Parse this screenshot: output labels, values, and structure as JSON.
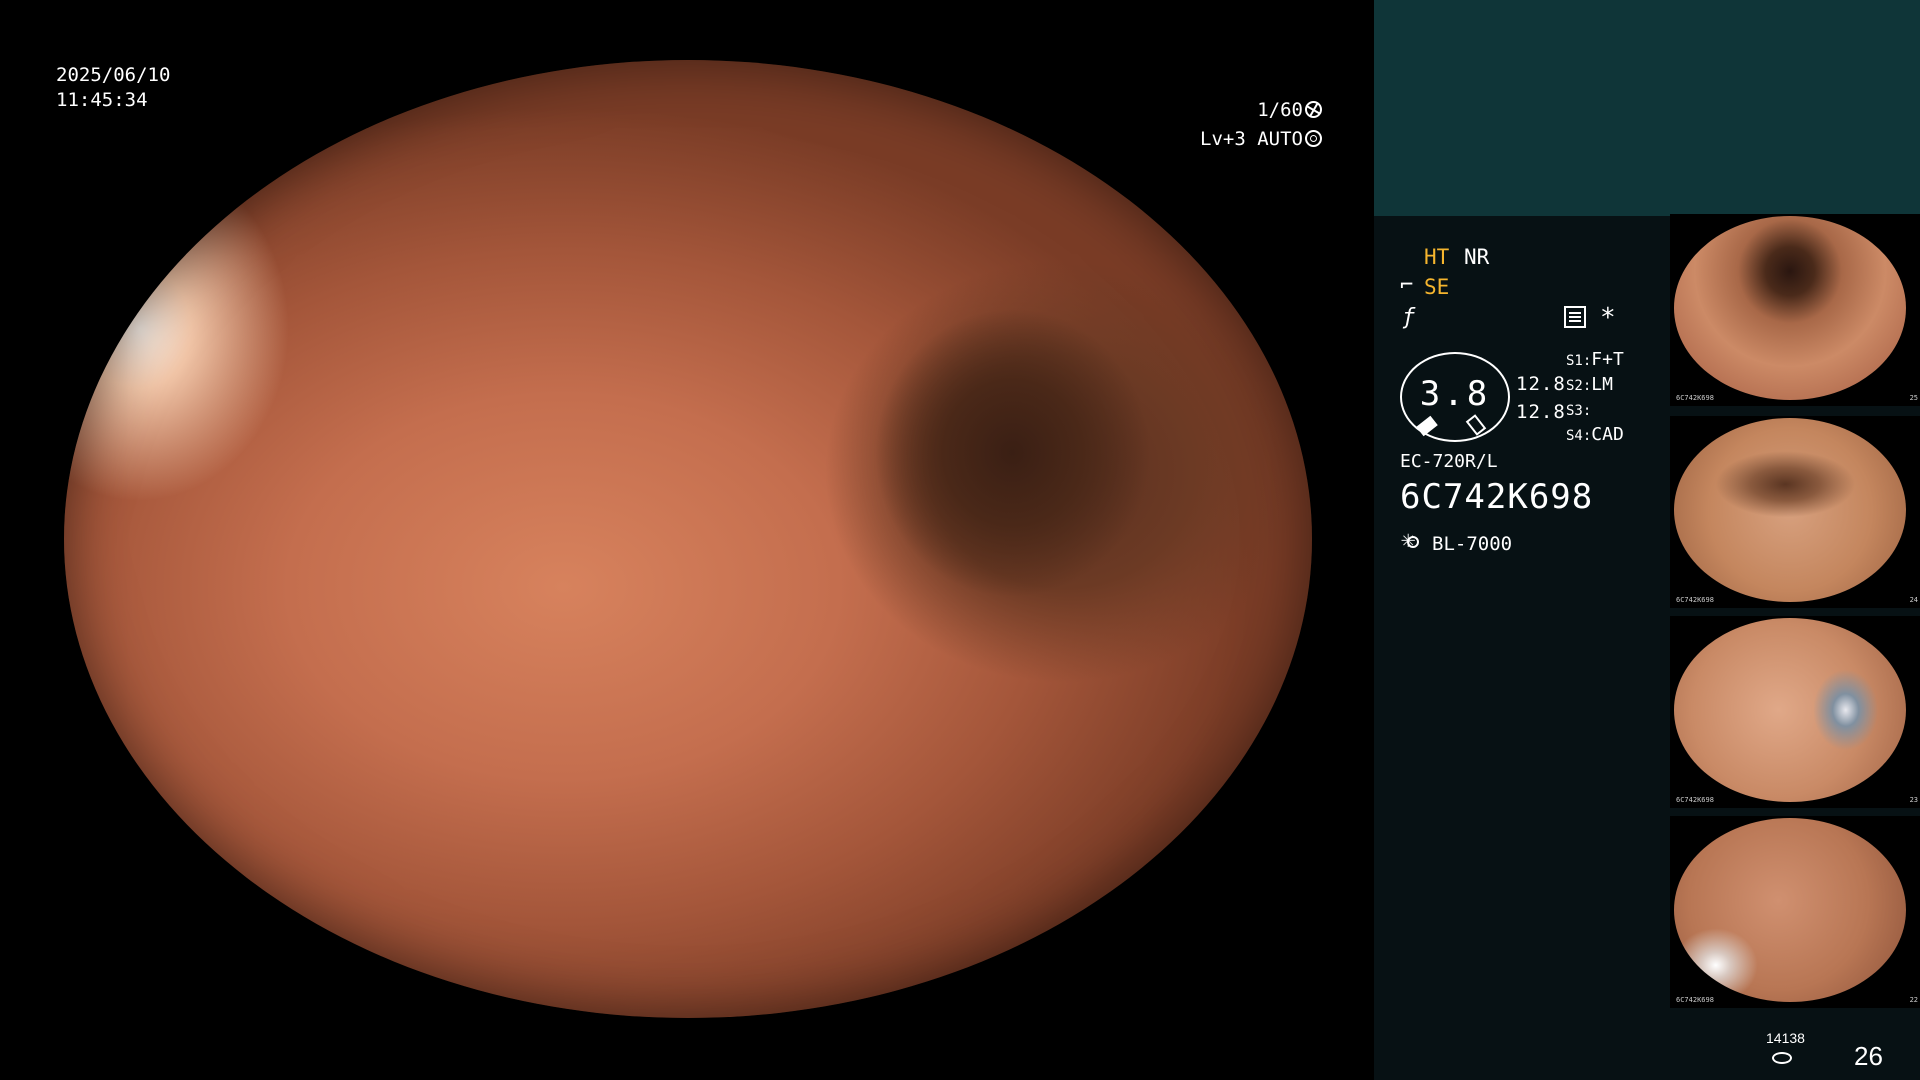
{
  "main": {
    "date": "2025/06/10",
    "time": "11:45:34",
    "shutter": "1/60",
    "level": "Lv+3 AUTO"
  },
  "panel": {
    "ht": "HT",
    "nr": "NR",
    "se": "SE",
    "se_icon": "scope-se-icon",
    "f_icon": "f-icon",
    "star": "*",
    "gauge_value": "3.8",
    "num1": "12.8",
    "num2": "12.8",
    "slots": [
      {
        "key": "S1",
        "value": "F+T"
      },
      {
        "key": "S2",
        "value": "LM"
      },
      {
        "key": "S3",
        "value": ""
      },
      {
        "key": "S4",
        "value": "CAD"
      }
    ],
    "model": "EC-720R/L",
    "serial": "6C742K698",
    "lamp": "BL-7000",
    "count": "14138",
    "page": "26"
  },
  "thumbnails": [
    {
      "caption": "6C742K698",
      "index": "25"
    },
    {
      "caption": "6C742K698",
      "index": "24"
    },
    {
      "caption": "6C742K698",
      "index": "23"
    },
    {
      "caption": "6C742K698",
      "index": "22"
    }
  ],
  "colors": {
    "accent_yellow": "#f5b52e",
    "panel_bg": "#071114",
    "panel_top_bg": "#0f3538"
  }
}
